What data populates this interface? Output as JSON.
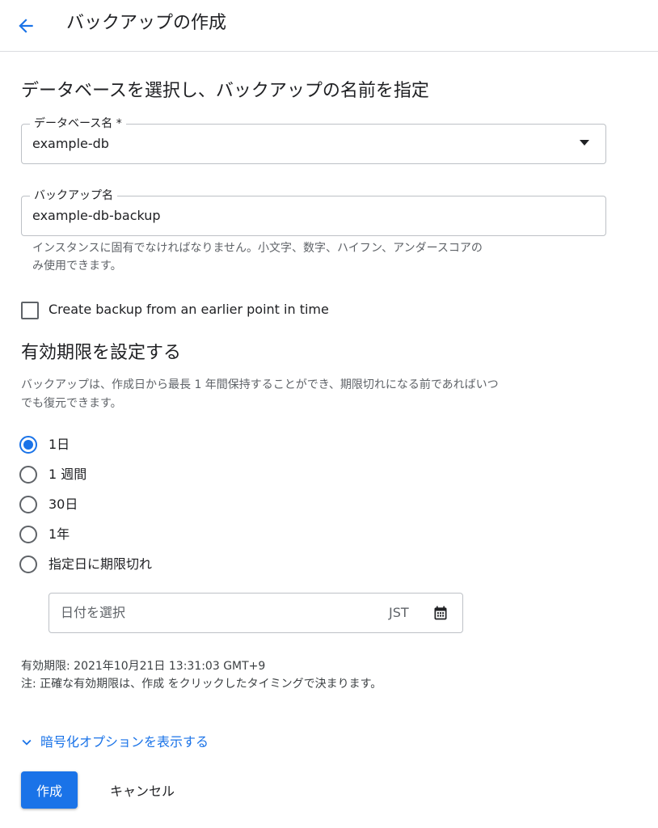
{
  "header": {
    "title": "バックアップの作成"
  },
  "section_select": {
    "title": "データベースを選択し、バックアップの名前を指定"
  },
  "database_field": {
    "label": "データベース名 *",
    "value": "example-db"
  },
  "backup_field": {
    "label": "バックアップ名",
    "value": "example-db-backup",
    "hint_line1": "インスタンスに固有でなければなりません。小文字、数字、ハイフン、アンダースコアの",
    "hint_line2": "み使用できます。"
  },
  "earlier_point": {
    "label": "Create backup from an earlier point in time",
    "checked": false
  },
  "expiry": {
    "title": "有効期限を設定する",
    "desc_line1": "バックアップは、作成日から最長 1 年間保持することができ、期限切れになる前であればいつ",
    "desc_line2": "でも復元できます。",
    "options": [
      {
        "label": "1日",
        "checked": true
      },
      {
        "label": "1 週間",
        "checked": false
      },
      {
        "label": "30日",
        "checked": false
      },
      {
        "label": "1年",
        "checked": false
      },
      {
        "label": "指定日に期限切れ",
        "checked": false
      }
    ],
    "date_placeholder": "日付を選択",
    "timezone": "JST",
    "expiry_info": "有効期限: 2021年10月21日 13:31:03 GMT+9",
    "note": "注: 正確な有効期限は、作成 をクリックしたタイミングで決まります。"
  },
  "encryption": {
    "label": "暗号化オプションを表示する"
  },
  "actions": {
    "create": "作成",
    "cancel": "キャンセル"
  },
  "colors": {
    "accent": "#1a73e8",
    "border": "#bdc1c6",
    "hint": "#5f6368"
  }
}
